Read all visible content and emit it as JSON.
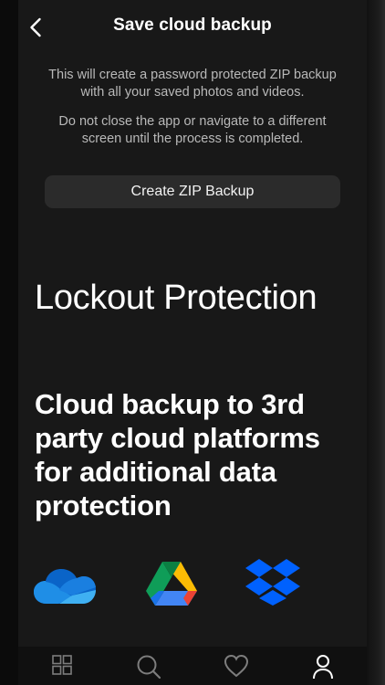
{
  "header": {
    "title": "Save cloud backup"
  },
  "description": {
    "line1": "This will create a password protected ZIP backup with all your saved photos and videos.",
    "line2": "Do not close the app or navigate to a different screen until the process is completed."
  },
  "actions": {
    "create_zip_label": "Create ZIP Backup"
  },
  "promo": {
    "heading": "Lockout Protection",
    "subheading": "Cloud backup to 3rd party cloud platforms for additional data protection"
  },
  "providers": [
    {
      "icon": "onedrive-icon"
    },
    {
      "icon": "google-drive-icon"
    },
    {
      "icon": "dropbox-icon"
    }
  ],
  "tabbar": {
    "items": [
      {
        "icon": "grid-icon"
      },
      {
        "icon": "search-icon"
      },
      {
        "icon": "heart-icon"
      },
      {
        "icon": "profile-icon"
      }
    ]
  },
  "colors": {
    "background": "#181818",
    "button": "#2b2b2b",
    "description_text": "#b9b9b9",
    "dropbox_blue": "#0061fe"
  }
}
